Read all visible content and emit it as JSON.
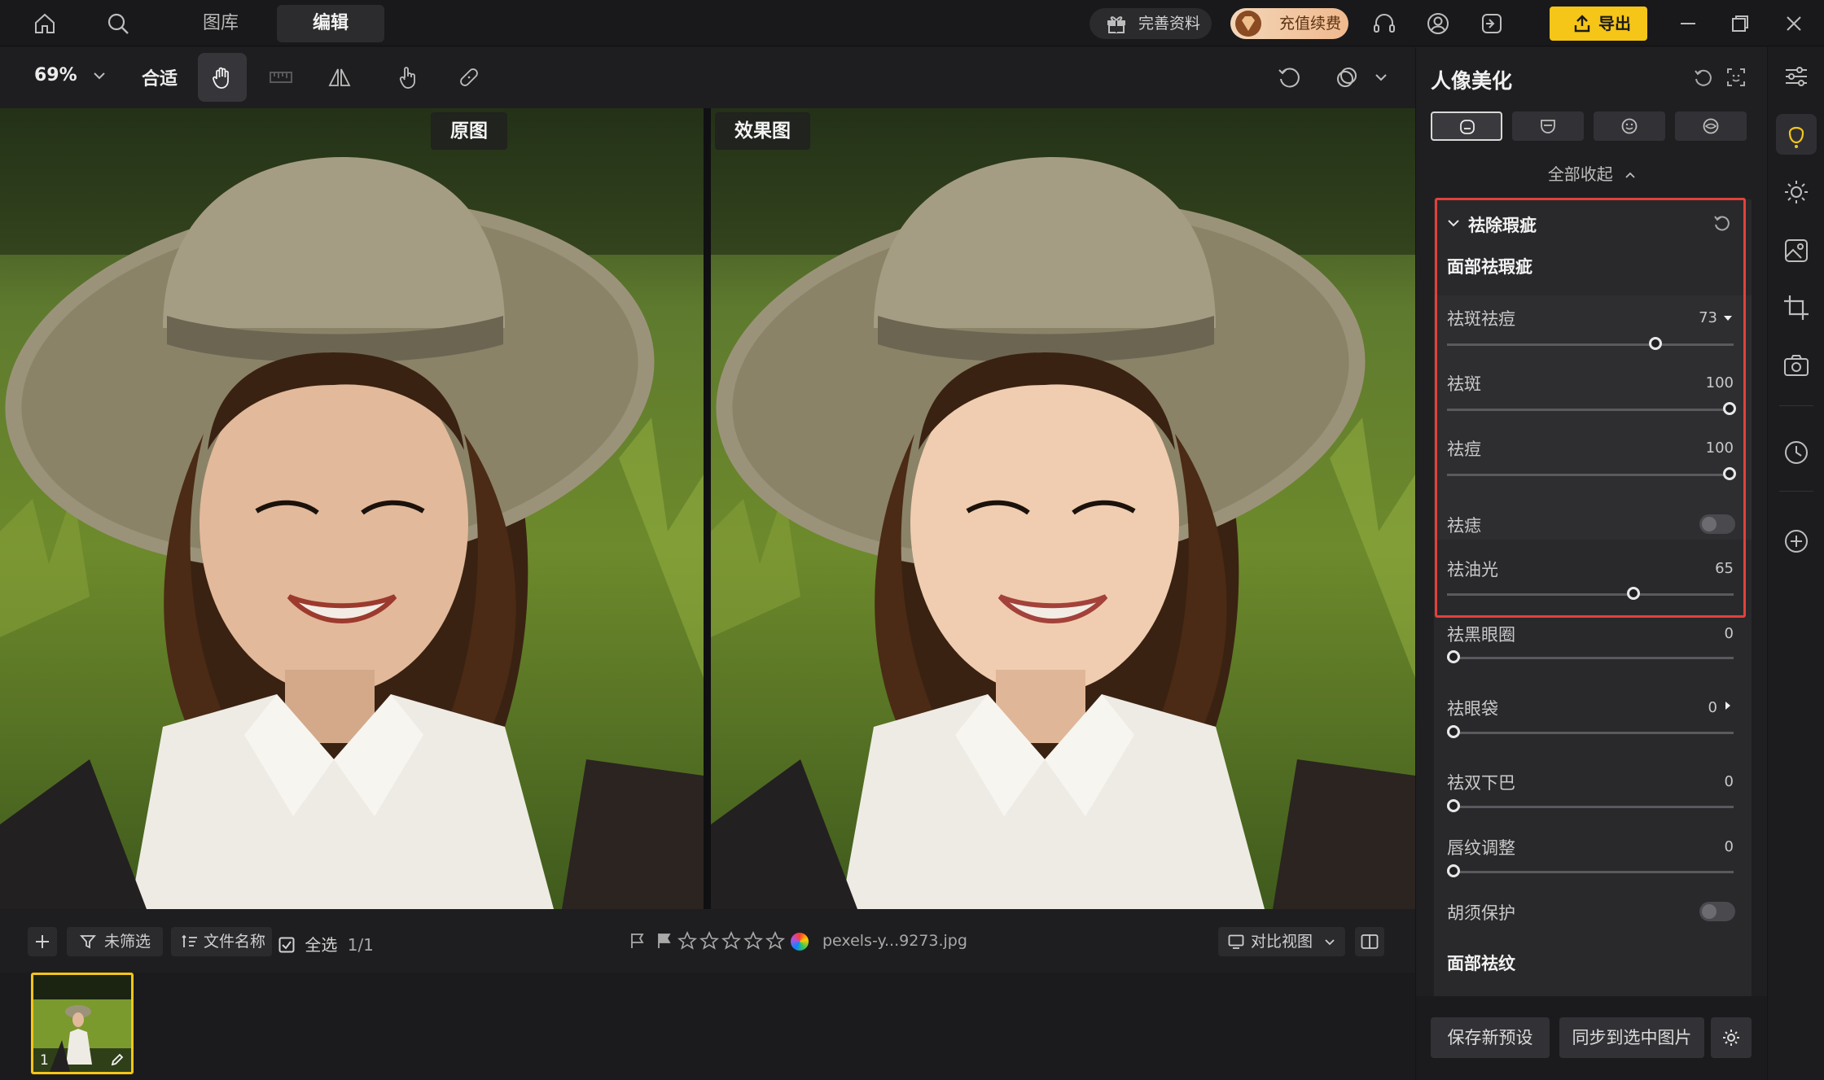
{
  "topbar": {
    "tabs": [
      {
        "label": "图库"
      },
      {
        "label": "编辑"
      }
    ],
    "profile_label": "完善资料",
    "recharge_label": "充值续费",
    "export_label": "导出",
    "accent": "#f5c518"
  },
  "toolbar": {
    "zoom_value": "69%",
    "fit_label": "合适"
  },
  "canvas": {
    "original_label": "原图",
    "result_label": "效果图"
  },
  "bottombar": {
    "filter_label": "未筛选",
    "sort_label": "文件名称",
    "select_all_label": "全选",
    "selection_count": "1/1",
    "filename": "pexels-y...9273.jpg",
    "compare_view_label": "对比视图",
    "thumb_index": "1"
  },
  "panel": {
    "title": "人像美化",
    "collapse_all_label": "全部收起",
    "section_title": "祛除瑕疵",
    "subsection_face": "面部祛瑕疵",
    "sliders": [
      {
        "label": "祛斑祛痘",
        "value": "73",
        "level": 73
      },
      {
        "label": "祛斑",
        "value": "100",
        "level": 100
      },
      {
        "label": "祛痘",
        "value": "100",
        "level": 100
      }
    ],
    "mole_label": "祛痣",
    "oil": {
      "label": "祛油光",
      "value": "65",
      "level": 65
    },
    "lower_sliders": [
      {
        "label": "祛黑眼圈",
        "value": "0",
        "level": 0
      },
      {
        "label": "祛眼袋",
        "value": "0",
        "level": 0
      },
      {
        "label": "祛双下巴",
        "value": "0",
        "level": 0
      },
      {
        "label": "唇纹调整",
        "value": "0",
        "level": 0
      }
    ],
    "beard_label": "胡须保护",
    "subsection_wrinkle": "面部祛纹",
    "save_preset_label": "保存新预设",
    "sync_label": "同步到选中图片",
    "highlight_color": "#e2413a"
  }
}
